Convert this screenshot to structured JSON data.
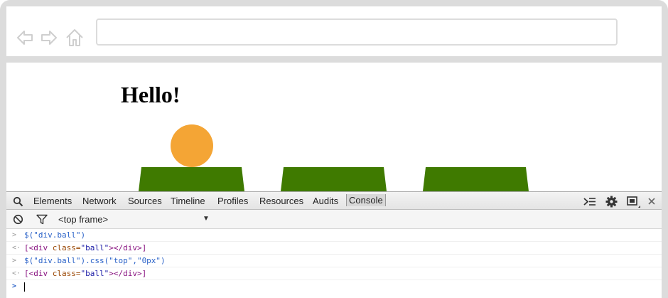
{
  "page": {
    "heading": "Hello!",
    "ball_color": "#f4a535",
    "platform_color": "#3f7a00"
  },
  "devtools": {
    "tabs": [
      {
        "label": "Elements"
      },
      {
        "label": "Network"
      },
      {
        "label": "Sources"
      },
      {
        "label": "Timeline"
      },
      {
        "label": "Profiles"
      },
      {
        "label": "Resources"
      },
      {
        "label": "Audits"
      },
      {
        "label": "Console",
        "active": true
      }
    ],
    "toolbar_icons": [
      "search-icon",
      "show-drawer-icon",
      "gear-icon",
      "dock-icon",
      "close-icon"
    ],
    "filter": {
      "frame": "<top frame>",
      "icons": [
        "clear-console-icon",
        "filter-icon"
      ]
    },
    "console": {
      "entries": [
        {
          "kind": "input",
          "prefix": ">",
          "text": "$(\"div.ball\")"
        },
        {
          "kind": "output",
          "prefix": "<·",
          "tag_open": "[<div",
          "attr": " class=",
          "value": "\"ball\"",
          "tag_close": "></div>]"
        },
        {
          "kind": "input",
          "prefix": ">",
          "text": "$(\"div.ball\").css(\"top\",\"0px\")"
        },
        {
          "kind": "output",
          "prefix": "<·",
          "tag_open": "[<div",
          "attr": " class=",
          "value": "\"ball\"",
          "tag_close": "></div>]"
        }
      ],
      "prompt": ">"
    }
  }
}
